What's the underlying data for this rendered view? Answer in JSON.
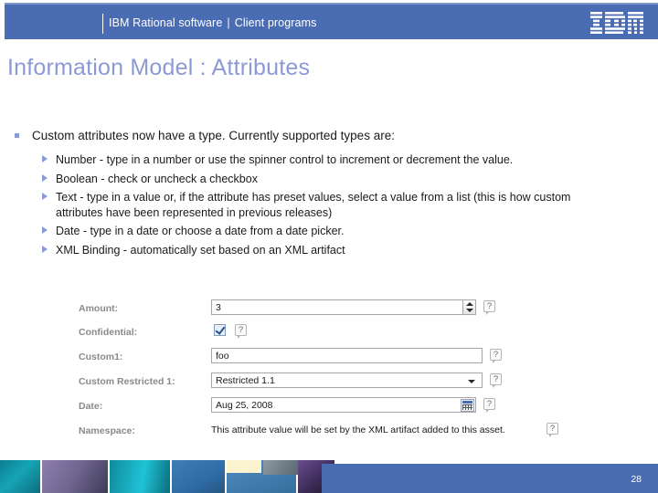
{
  "header": {
    "brand": "IBM Rational software",
    "separator": "|",
    "program": "Client programs",
    "logo_alt": "IBM"
  },
  "title": "Information Model : Attributes",
  "bullets": [
    {
      "text": "Custom attributes now have a type. Currently supported types are:",
      "children": [
        "Number - type in a number or use the spinner control to increment or decrement the value.",
        "Boolean - check or uncheck a checkbox",
        "Text - type in a value or, if the attribute has preset values, select a value from a list (this is how custom attributes have been represented in previous releases)",
        "Date - type in a date or choose a date from a date picker.",
        "XML Binding - automatically set based on an XML artifact"
      ]
    }
  ],
  "form": {
    "rows": [
      {
        "label": "Amount:",
        "control": "spinner",
        "value": "3",
        "help": "?"
      },
      {
        "label": "Confidential:",
        "control": "checkbox",
        "checked": true,
        "help": "?"
      },
      {
        "label": "Custom1:",
        "control": "text",
        "value": "foo",
        "help": "?"
      },
      {
        "label": "Custom Restricted 1:",
        "control": "select",
        "value": "Restricted 1.1",
        "help": "?"
      },
      {
        "label": "Date:",
        "control": "date",
        "value": "Aug 25, 2008",
        "help": "?"
      },
      {
        "label": "Namespace:",
        "control": "static",
        "value": "This attribute value will be set by the XML artifact added to this asset.",
        "help": "?"
      }
    ]
  },
  "footer": {
    "page_number": "28"
  },
  "colors": {
    "header_blue": "#4a6cb3",
    "header_top_border": "#7e97cd",
    "title_blue": "#8b9ad6",
    "bullet_marker": "#8b9ad6",
    "body_text": "#1a1a1a",
    "form_label": "#8a8a8a"
  }
}
